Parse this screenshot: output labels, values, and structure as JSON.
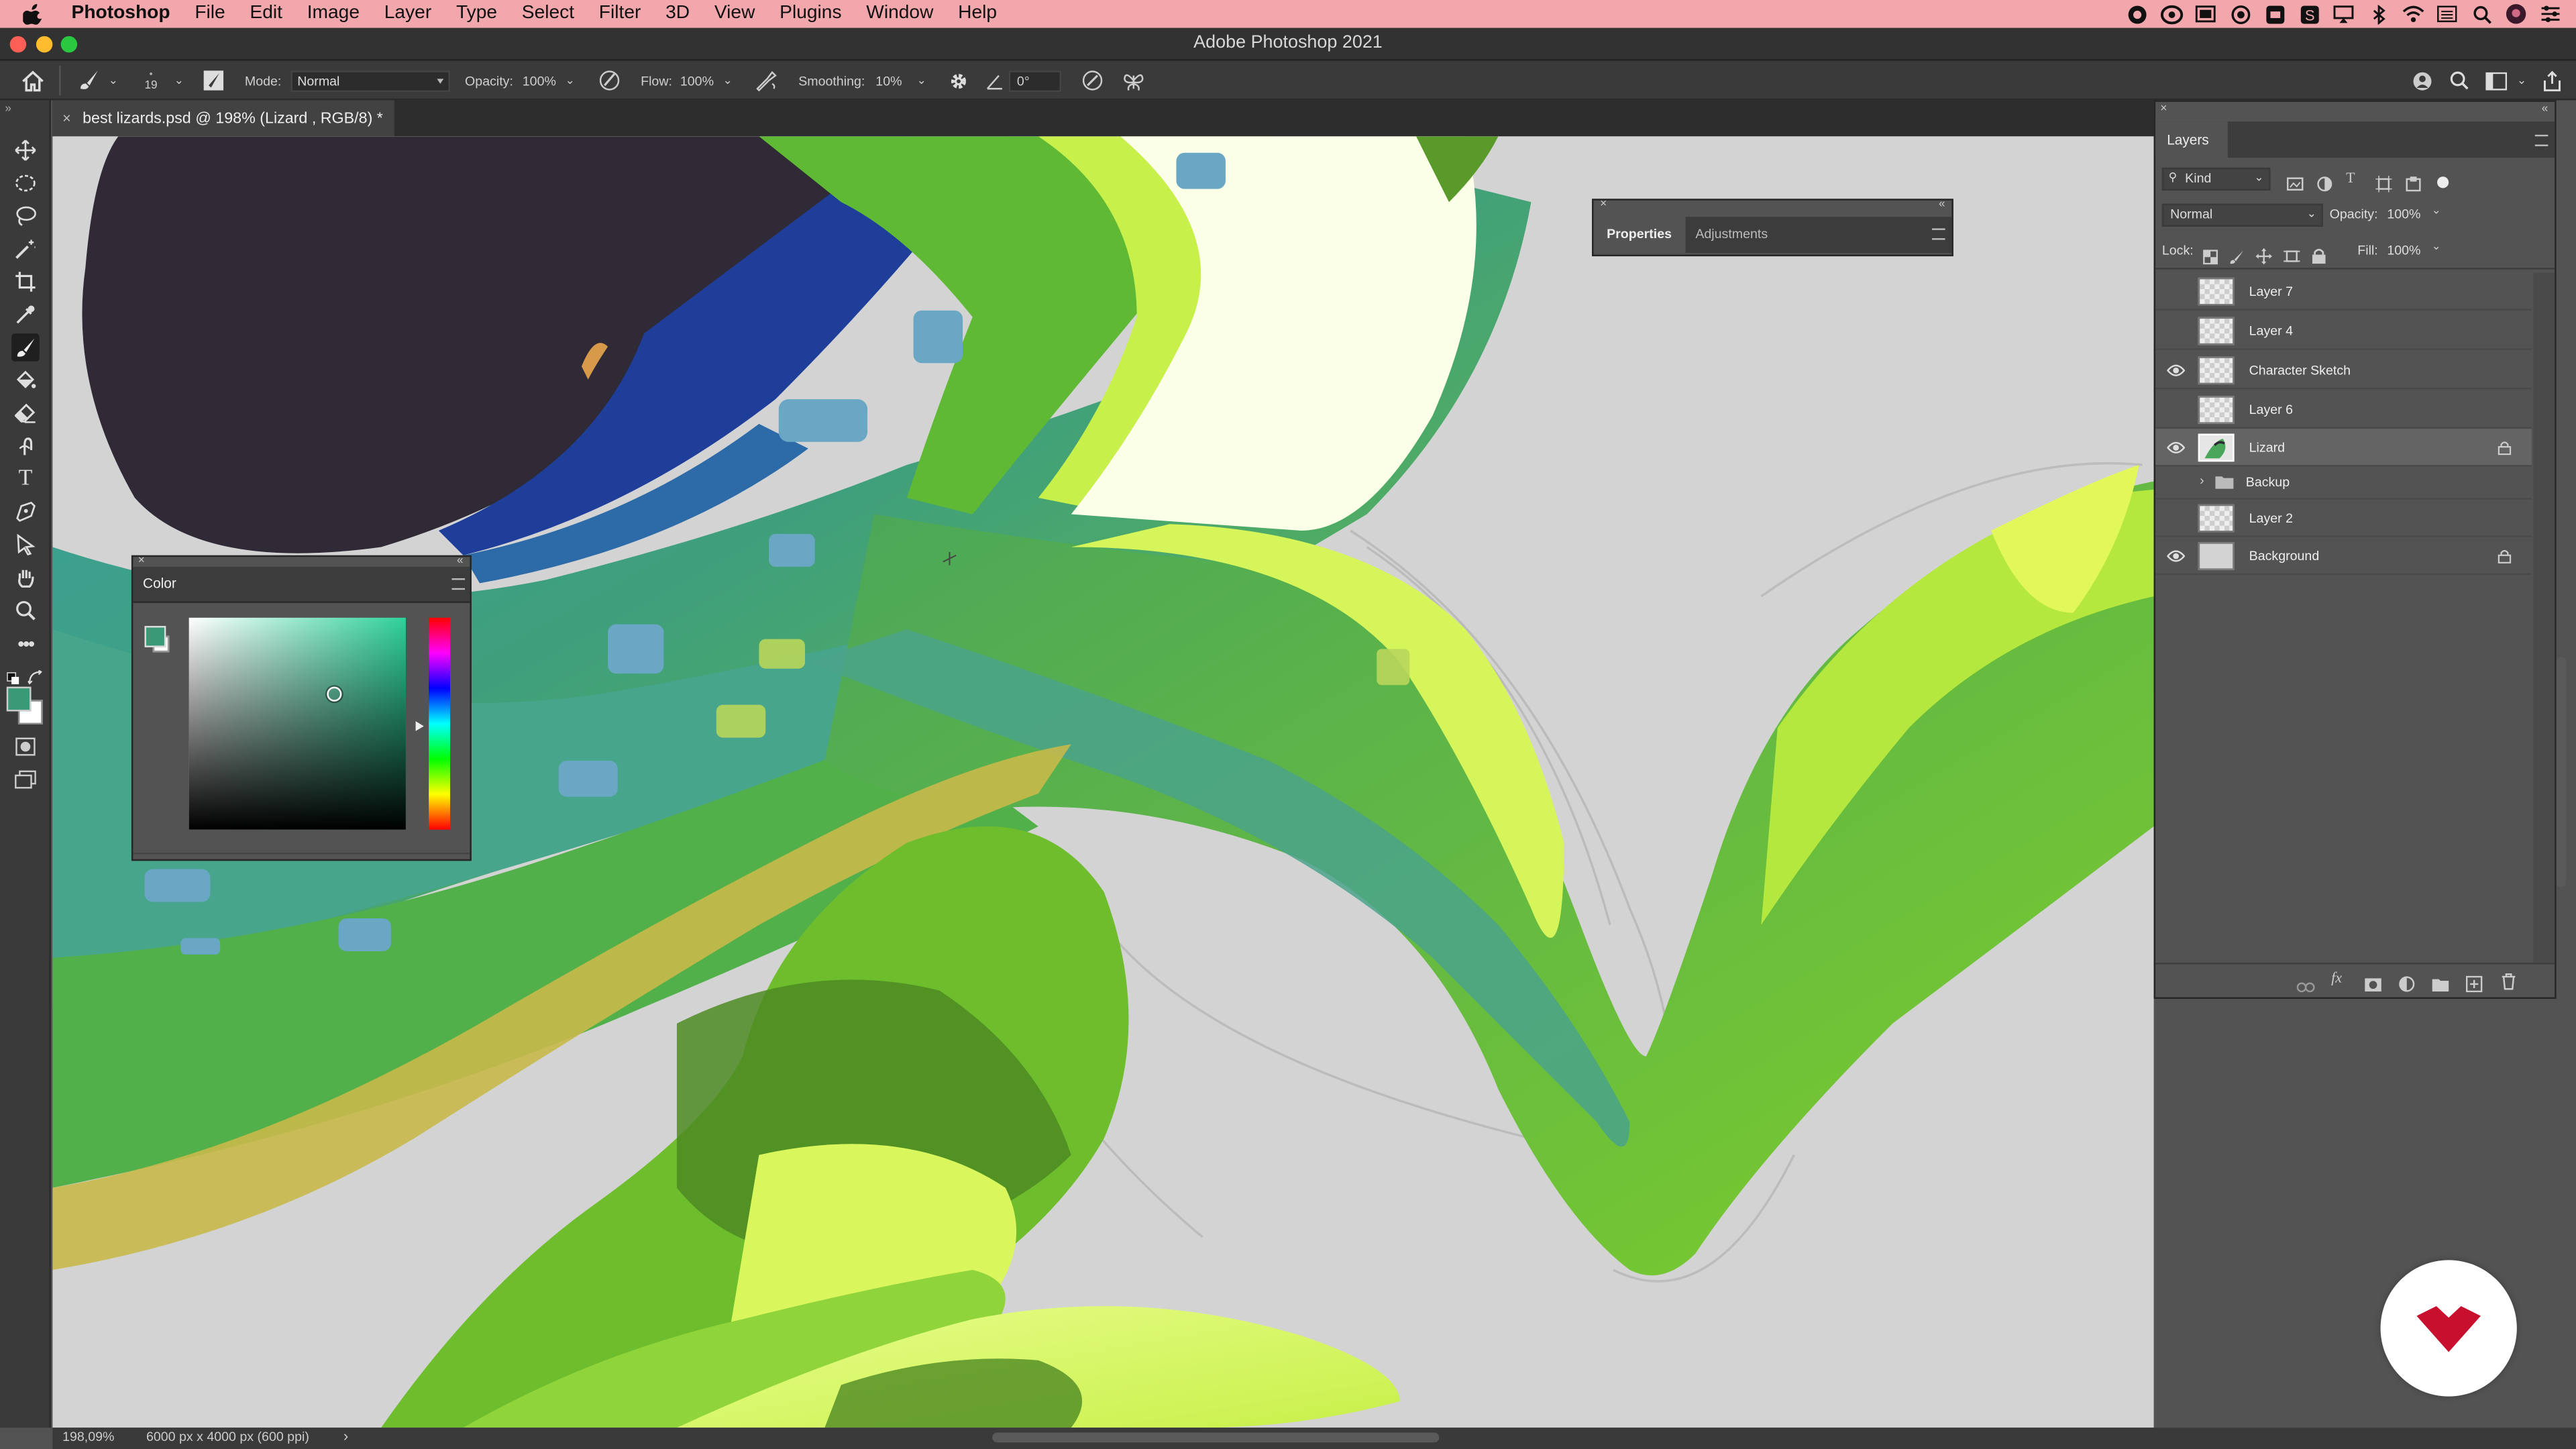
{
  "menubar": {
    "app_name": "Photoshop",
    "items": [
      "File",
      "Edit",
      "Image",
      "Layer",
      "Type",
      "Select",
      "Filter",
      "3D",
      "View",
      "Plugins",
      "Window",
      "Help"
    ],
    "status_icons": [
      "creative-cloud-icon",
      "cc-libraries-icon",
      "screen-icon",
      "record-icon",
      "vpn-icon",
      "s-icon",
      "airplay-icon",
      "bluetooth-icon",
      "wifi-icon",
      "keyboard-icon",
      "search-icon",
      "user-avatar-icon",
      "control-center-icon"
    ]
  },
  "window": {
    "title": "Adobe Photoshop 2021"
  },
  "options_bar": {
    "brush_size": "19",
    "mode_label": "Mode:",
    "mode_value": "Normal",
    "opacity_label": "Opacity:",
    "opacity_value": "100%",
    "flow_label": "Flow:",
    "flow_value": "100%",
    "smoothing_label": "Smoothing:",
    "smoothing_value": "10%",
    "angle_value": "0°"
  },
  "document": {
    "tab_title": "best lizards.psd @ 198% (Lizard , RGB/8) *"
  },
  "status_bar": {
    "zoom": "198,09%",
    "doc_info": "6000 px x 4000 px (600 ppi)"
  },
  "color_panel": {
    "title": "Color",
    "foreground": "#3a9a78",
    "background": "#ffffff",
    "hue_color": "#2fd19a"
  },
  "properties_panel": {
    "tabs": [
      "Properties",
      "Adjustments"
    ]
  },
  "layers_panel": {
    "title": "Layers",
    "filter_label": "Kind",
    "blend_mode": "Normal",
    "opacity_label": "Opacity:",
    "opacity_value": "100%",
    "lock_label": "Lock:",
    "fill_label": "Fill:",
    "fill_value": "100%",
    "layers": [
      {
        "name": "Layer 7",
        "visible": false,
        "locked": false,
        "selected": false
      },
      {
        "name": "Layer 4",
        "visible": false,
        "locked": false,
        "selected": false
      },
      {
        "name": "Character Sketch",
        "visible": true,
        "locked": false,
        "selected": false
      },
      {
        "name": "Layer 6",
        "visible": false,
        "locked": false,
        "selected": false
      },
      {
        "name": "Lizard",
        "visible": true,
        "locked": true,
        "selected": true
      },
      {
        "name": "Backup",
        "visible": false,
        "locked": false,
        "selected": false,
        "group": true
      },
      {
        "name": "Layer 2",
        "visible": false,
        "locked": false,
        "selected": false
      },
      {
        "name": "Background",
        "visible": true,
        "locked": true,
        "selected": false
      }
    ]
  },
  "colors": {
    "menubar_bg": "#f2a7ad",
    "panel_bg": "#535353",
    "canvas_bg": "#d3d3d3",
    "logo_red": "#c8102e"
  }
}
